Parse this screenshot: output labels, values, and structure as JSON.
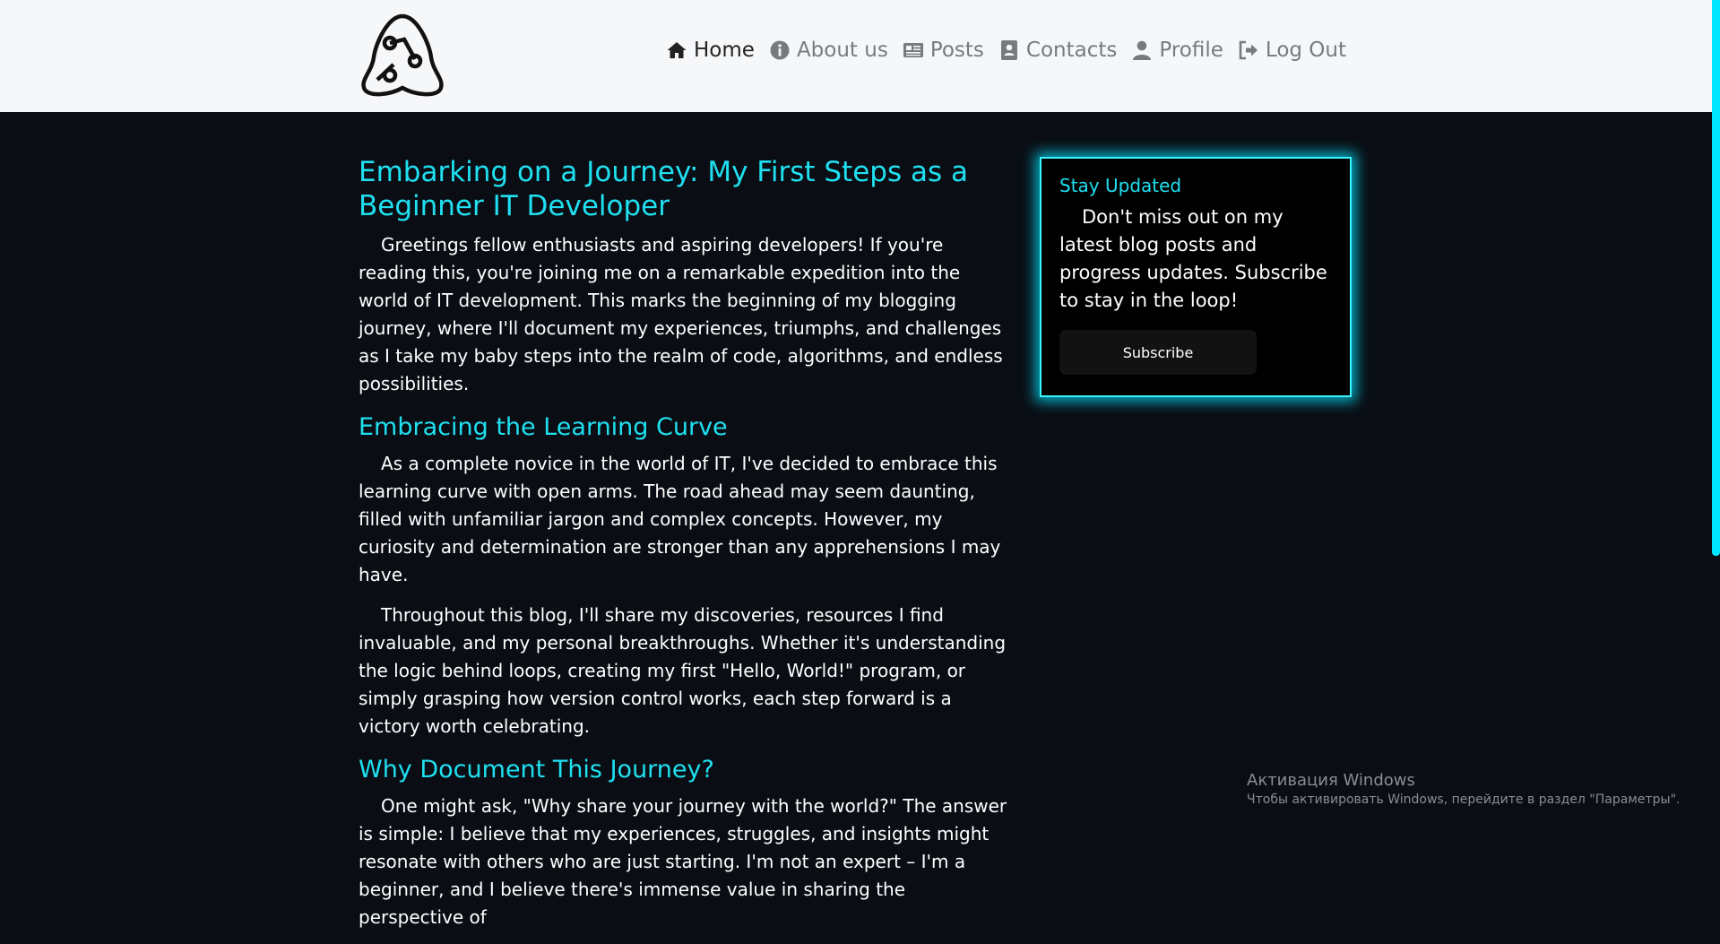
{
  "nav": {
    "items": [
      {
        "label": "Home",
        "icon": "home-icon"
      },
      {
        "label": "About us",
        "icon": "info-icon"
      },
      {
        "label": "Posts",
        "icon": "newspaper-icon"
      },
      {
        "label": "Contacts",
        "icon": "address-book-icon"
      },
      {
        "label": "Profile",
        "icon": "user-icon"
      },
      {
        "label": "Log Out",
        "icon": "sign-out-icon"
      }
    ]
  },
  "article": {
    "title": "Embarking on a Journey: My First Steps as a Beginner IT Developer",
    "intro": "Greetings fellow enthusiasts and aspiring developers! If you're reading this, you're joining me on a remarkable expedition into the world of IT development. This marks the beginning of my blogging journey, where I'll document my experiences, triumphs, and challenges as I take my baby steps into the realm of code, algorithms, and endless possibilities.",
    "section1_title": "Embracing the Learning Curve",
    "section1_p1": "As a complete novice in the world of IT, I've decided to embrace this learning curve with open arms. The road ahead may seem daunting, filled with unfamiliar jargon and complex concepts. However, my curiosity and determination are stronger than any apprehensions I may have.",
    "section1_p2": "Throughout this blog, I'll share my discoveries, resources I find invaluable, and my personal breakthroughs. Whether it's understanding the logic behind loops, creating my first \"Hello, World!\" program, or simply grasping how version control works, each step forward is a victory worth celebrating.",
    "section2_title": "Why Document This Journey?",
    "section2_p1": "One might ask, \"Why share your journey with the world?\" The answer is simple: I believe that my experiences, struggles, and insights might resonate with others who are just starting. I'm not an expert – I'm a beginner, and I believe there's immense value in sharing the perspective of"
  },
  "sidebar": {
    "title": "Stay Updated",
    "text": "Don't miss out on my latest blog posts and progress updates. Subscribe to stay in the loop!",
    "button_label": "Subscribe"
  },
  "watermark": {
    "title": "Активация Windows",
    "subtitle": "Чтобы активировать Windows, перейдите в раздел \"Параметры\"."
  },
  "colors": {
    "accent": "#1fe0f0",
    "background": "#0a0d14",
    "navbar": "#f6f7f9"
  }
}
